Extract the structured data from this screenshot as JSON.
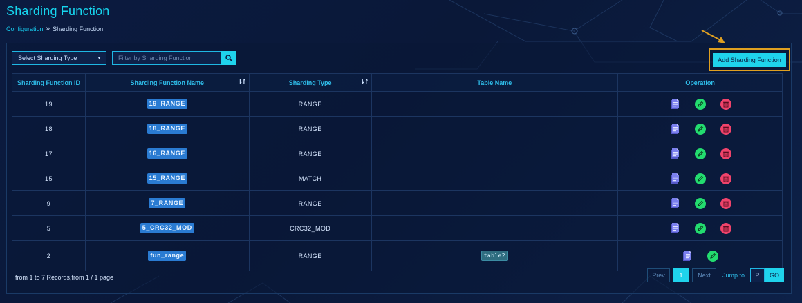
{
  "page": {
    "title": "Sharding Function"
  },
  "breadcrumb": {
    "root": "Configuration",
    "separator": "»",
    "current": "Sharding Function"
  },
  "toolbar": {
    "select_label": "Select Sharding Type",
    "filter_placeholder": "Filter by Sharding Function",
    "add_label": "Add Sharding Function"
  },
  "table": {
    "headers": {
      "id": "Sharding Function ID",
      "name": "Sharding Function Name",
      "type": "Sharding Type",
      "table": "Table Name",
      "operation": "Operation"
    },
    "rows": [
      {
        "id": "19",
        "name": "19_RANGE",
        "type": "RANGE",
        "table": ""
      },
      {
        "id": "18",
        "name": "18_RANGE",
        "type": "RANGE",
        "table": ""
      },
      {
        "id": "17",
        "name": "16_RANGE",
        "type": "RANGE",
        "table": ""
      },
      {
        "id": "15",
        "name": "15_RANGE",
        "type": "MATCH",
        "table": ""
      },
      {
        "id": "9",
        "name": "7_RANGE",
        "type": "RANGE",
        "table": ""
      },
      {
        "id": "5",
        "name": "5_CRC32_MOD",
        "type": "CRC32_MOD",
        "table": ""
      },
      {
        "id": "2",
        "name": "fun_range",
        "type": "RANGE",
        "table": "table2"
      }
    ]
  },
  "footer": {
    "summary": "from 1 to 7 Records,from 1 / 1 page",
    "prev": "Prev",
    "page": "1",
    "next": "Next",
    "jump_label": "Jump to",
    "jump_value": "P",
    "go": "GO"
  },
  "colors": {
    "accent": "#1fd3ec",
    "edit": "#23dc6f",
    "delete": "#f0436b",
    "doc": "#6f74e6",
    "highlight": "#e0a020"
  }
}
